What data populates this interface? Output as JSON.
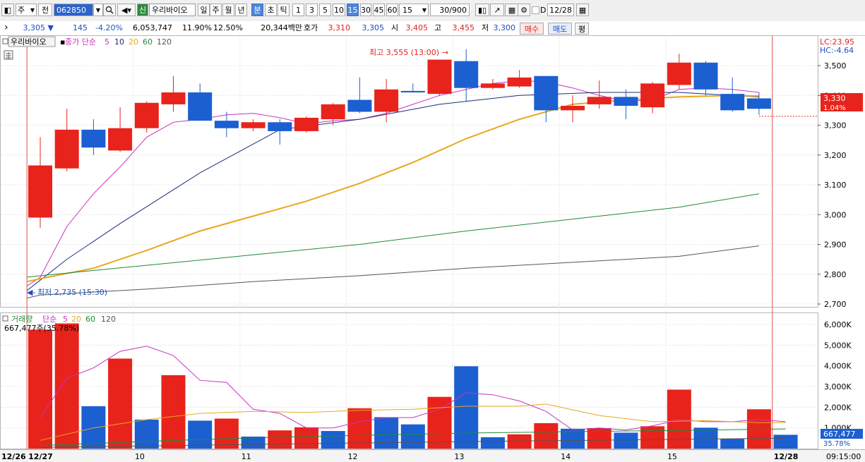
{
  "toolbar": {
    "market": "주",
    "view": "전",
    "code": "062850",
    "name": "우리바이오",
    "credit_badge": "신",
    "periods": [
      "일",
      "주",
      "월",
      "년",
      "분",
      "초",
      "틱"
    ],
    "selected_period": "분",
    "intervals": [
      "1",
      "3",
      "5",
      "10",
      "15",
      "30",
      "45",
      "60"
    ],
    "selected_interval": "15",
    "interval_value": "15",
    "count": "30/900",
    "date_value": "12/28",
    "date_checkbox_label": "D"
  },
  "quote": {
    "price": "3,305",
    "change": "145",
    "change_pct": "-4.20%",
    "volume": "6,053,747",
    "turnover_pct": "11.90%",
    "rate2": "12.50%",
    "amount": "20,344백만",
    "bid_label": "호가",
    "bid": "3,310",
    "ask": "3,305",
    "open_label": "시",
    "open": "3,405",
    "high_label": "고",
    "high": "3,455",
    "low_label": "저",
    "low": "3,300",
    "buy_button": "매수",
    "sell_button": "매도",
    "avg_button": "평"
  },
  "price_panel": {
    "stock_label": "우리바이오",
    "ma_title": "종가 단순",
    "ma_periods": [
      "5",
      "10",
      "20",
      "60",
      "120"
    ],
    "lc": "LC:23.95",
    "hc": "HC:-4.64",
    "current_price": "3,330",
    "current_pct": "1.04%",
    "high_annotation": "최고 3,555 (13:00)",
    "low_annotation": "최저 2,735 (15:30)"
  },
  "volume_panel": {
    "title": "거래량",
    "ma_title": "단순",
    "ma_periods": [
      "5",
      "20",
      "60",
      "120"
    ],
    "info": "667,477주(35.78%)",
    "current_volume": "667,477",
    "current_pct": "35.78%"
  },
  "xaxis": {
    "time_label": "09:15:00"
  },
  "colors": {
    "up": "#e8231b",
    "down": "#1b5fd1",
    "ma5": "#c833c0",
    "ma10": "#1a2f7a",
    "ma20": "#e8a81c",
    "ma60": "#1f8a3a",
    "ma120": "#555555"
  },
  "chart_data": {
    "type": "candlestick",
    "price_ylim": [
      2700,
      3600
    ],
    "price_ticks": [
      "3,500",
      "3,400",
      "3,300",
      "3,200",
      "3,100",
      "3,000",
      "2,900",
      "2,800",
      "2,700"
    ],
    "volume_ylim": [
      0,
      6000000
    ],
    "volume_ticks": [
      "6,000K",
      "5,000K",
      "4,000K",
      "3,000K",
      "2,000K",
      "1,000K"
    ],
    "x_labels": [
      {
        "label": "12/26",
        "index": -1
      },
      {
        "label": "12/27",
        "index": 0
      },
      {
        "label": "10",
        "index": 4
      },
      {
        "label": "11",
        "index": 8
      },
      {
        "label": "12",
        "index": 12
      },
      {
        "label": "13",
        "index": 16
      },
      {
        "label": "14",
        "index": 20
      },
      {
        "label": "15",
        "index": 24
      },
      {
        "label": "12/28",
        "index": 28
      }
    ],
    "candles": [
      {
        "o": 2990,
        "h": 3260,
        "l": 2955,
        "c": 3165
      },
      {
        "o": 3155,
        "h": 3355,
        "l": 3145,
        "c": 3285
      },
      {
        "o": 3285,
        "h": 3320,
        "l": 3200,
        "c": 3225
      },
      {
        "o": 3215,
        "h": 3360,
        "l": 3210,
        "c": 3290
      },
      {
        "o": 3290,
        "h": 3380,
        "l": 3275,
        "c": 3375
      },
      {
        "o": 3370,
        "h": 3465,
        "l": 3345,
        "c": 3410
      },
      {
        "o": 3410,
        "h": 3440,
        "l": 3315,
        "c": 3315
      },
      {
        "o": 3315,
        "h": 3345,
        "l": 3260,
        "c": 3290
      },
      {
        "o": 3290,
        "h": 3320,
        "l": 3280,
        "c": 3310
      },
      {
        "o": 3310,
        "h": 3320,
        "l": 3235,
        "c": 3280
      },
      {
        "o": 3280,
        "h": 3330,
        "l": 3275,
        "c": 3325
      },
      {
        "o": 3320,
        "h": 3375,
        "l": 3300,
        "c": 3370
      },
      {
        "o": 3385,
        "h": 3460,
        "l": 3340,
        "c": 3345
      },
      {
        "o": 3345,
        "h": 3455,
        "l": 3310,
        "c": 3420
      },
      {
        "o": 3415,
        "h": 3440,
        "l": 3410,
        "c": 3410
      },
      {
        "o": 3405,
        "h": 3520,
        "l": 3400,
        "c": 3520
      },
      {
        "o": 3515,
        "h": 3555,
        "l": 3380,
        "c": 3425
      },
      {
        "o": 3425,
        "h": 3455,
        "l": 3420,
        "c": 3440
      },
      {
        "o": 3430,
        "h": 3485,
        "l": 3425,
        "c": 3460
      },
      {
        "o": 3465,
        "h": 3465,
        "l": 3310,
        "c": 3350
      },
      {
        "o": 3350,
        "h": 3400,
        "l": 3310,
        "c": 3365
      },
      {
        "o": 3370,
        "h": 3450,
        "l": 3355,
        "c": 3395
      },
      {
        "o": 3395,
        "h": 3420,
        "l": 3320,
        "c": 3365
      },
      {
        "o": 3360,
        "h": 3445,
        "l": 3340,
        "c": 3440
      },
      {
        "o": 3435,
        "h": 3540,
        "l": 3420,
        "c": 3510
      },
      {
        "o": 3510,
        "h": 3515,
        "l": 3400,
        "c": 3420
      },
      {
        "o": 3405,
        "h": 3460,
        "l": 3345,
        "c": 3350
      },
      {
        "o": 3390,
        "h": 3410,
        "l": 3335,
        "c": 3355
      }
    ],
    "volumes": [
      {
        "v": 5750000,
        "up": true
      },
      {
        "v": 6050000,
        "up": true
      },
      {
        "v": 2050000,
        "up": false
      },
      {
        "v": 4350000,
        "up": true
      },
      {
        "v": 1400000,
        "up": false
      },
      {
        "v": 3550000,
        "up": true
      },
      {
        "v": 1350000,
        "up": false
      },
      {
        "v": 1450000,
        "up": true
      },
      {
        "v": 580000,
        "up": false
      },
      {
        "v": 880000,
        "up": true
      },
      {
        "v": 1030000,
        "up": true
      },
      {
        "v": 850000,
        "up": false
      },
      {
        "v": 1950000,
        "up": true
      },
      {
        "v": 1520000,
        "up": false
      },
      {
        "v": 1170000,
        "up": false
      },
      {
        "v": 2500000,
        "up": true
      },
      {
        "v": 3980000,
        "up": false
      },
      {
        "v": 550000,
        "up": false
      },
      {
        "v": 690000,
        "up": true
      },
      {
        "v": 1230000,
        "up": true
      },
      {
        "v": 960000,
        "up": false
      },
      {
        "v": 990000,
        "up": true
      },
      {
        "v": 770000,
        "up": false
      },
      {
        "v": 1080000,
        "up": true
      },
      {
        "v": 2850000,
        "up": true
      },
      {
        "v": 1010000,
        "up": false
      },
      {
        "v": 470000,
        "up": false
      },
      {
        "v": 1900000,
        "up": true
      },
      {
        "v": 667477,
        "up": false
      }
    ],
    "ma_lines": [
      {
        "name": "5",
        "points": [
          [
            -0.5,
            2760
          ],
          [
            0,
            2790
          ],
          [
            1,
            2960
          ],
          [
            2,
            3070
          ],
          [
            3,
            3160
          ],
          [
            4,
            3260
          ],
          [
            5,
            3310
          ],
          [
            6,
            3320
          ],
          [
            7,
            3335
          ],
          [
            8,
            3340
          ],
          [
            9,
            3325
          ],
          [
            10,
            3305
          ],
          [
            11,
            3315
          ],
          [
            12,
            3320
          ],
          [
            13,
            3340
          ],
          [
            14,
            3370
          ],
          [
            15,
            3400
          ],
          [
            16,
            3420
          ],
          [
            17,
            3440
          ],
          [
            18,
            3450
          ],
          [
            19,
            3445
          ],
          [
            20,
            3425
          ],
          [
            21,
            3400
          ],
          [
            22,
            3380
          ],
          [
            23,
            3385
          ],
          [
            24,
            3420
          ],
          [
            25,
            3425
          ],
          [
            26,
            3420
          ],
          [
            27,
            3410
          ]
        ]
      },
      {
        "name": "10",
        "points": [
          [
            -0.5,
            2745
          ],
          [
            0,
            2780
          ],
          [
            1,
            2850
          ],
          [
            3,
            2970
          ],
          [
            6,
            3140
          ],
          [
            9,
            3285
          ],
          [
            12,
            3320
          ],
          [
            15,
            3370
          ],
          [
            18,
            3400
          ],
          [
            21,
            3410
          ],
          [
            24,
            3410
          ],
          [
            27,
            3395
          ]
        ]
      },
      {
        "name": "20",
        "points": [
          [
            -0.5,
            2775
          ],
          [
            0,
            2785
          ],
          [
            2,
            2820
          ],
          [
            4,
            2880
          ],
          [
            6,
            2945
          ],
          [
            8,
            2995
          ],
          [
            10,
            3045
          ],
          [
            12,
            3105
          ],
          [
            14,
            3175
          ],
          [
            16,
            3255
          ],
          [
            18,
            3320
          ],
          [
            20,
            3370
          ],
          [
            22,
            3385
          ],
          [
            24,
            3395
          ],
          [
            26,
            3400
          ],
          [
            27,
            3398
          ]
        ]
      },
      {
        "name": "60",
        "points": [
          [
            -0.5,
            2790
          ],
          [
            0,
            2795
          ],
          [
            4,
            2830
          ],
          [
            8,
            2865
          ],
          [
            12,
            2900
          ],
          [
            16,
            2945
          ],
          [
            20,
            2985
          ],
          [
            24,
            3025
          ],
          [
            27,
            3070
          ]
        ]
      },
      {
        "name": "120",
        "points": [
          [
            -0.5,
            2720
          ],
          [
            0,
            2730
          ],
          [
            4,
            2750
          ],
          [
            8,
            2775
          ],
          [
            12,
            2795
          ],
          [
            16,
            2820
          ],
          [
            20,
            2840
          ],
          [
            24,
            2860
          ],
          [
            27,
            2895
          ]
        ]
      }
    ],
    "vol_ma_lines": [
      {
        "name": "5",
        "points": [
          [
            0,
            1500000
          ],
          [
            1,
            3400000
          ],
          [
            2,
            3900000
          ],
          [
            3,
            4700000
          ],
          [
            4,
            4950000
          ],
          [
            5,
            4500000
          ],
          [
            6,
            3300000
          ],
          [
            7,
            3200000
          ],
          [
            8,
            1900000
          ],
          [
            9,
            1700000
          ],
          [
            10,
            1000000
          ],
          [
            11,
            1000000
          ],
          [
            12,
            1300000
          ],
          [
            13,
            1500000
          ],
          [
            14,
            1500000
          ],
          [
            15,
            1900000
          ],
          [
            16,
            2700000
          ],
          [
            17,
            2600000
          ],
          [
            18,
            2300000
          ],
          [
            19,
            1800000
          ],
          [
            20,
            900000
          ],
          [
            21,
            1000000
          ],
          [
            22,
            900000
          ],
          [
            23,
            1100000
          ],
          [
            24,
            1400000
          ],
          [
            25,
            1300000
          ],
          [
            26,
            1300000
          ],
          [
            27,
            1400000
          ],
          [
            28,
            1300000
          ]
        ]
      },
      {
        "name": "20",
        "points": [
          [
            0,
            400000
          ],
          [
            2,
            1000000
          ],
          [
            4,
            1400000
          ],
          [
            6,
            1700000
          ],
          [
            8,
            1800000
          ],
          [
            10,
            1750000
          ],
          [
            12,
            1850000
          ],
          [
            14,
            1900000
          ],
          [
            16,
            2050000
          ],
          [
            18,
            2050000
          ],
          [
            19,
            2150000
          ],
          [
            21,
            1600000
          ],
          [
            23,
            1300000
          ],
          [
            25,
            1350000
          ],
          [
            27,
            1250000
          ],
          [
            28,
            1250000
          ]
        ]
      },
      {
        "name": "60",
        "points": [
          [
            0,
            150000
          ],
          [
            4,
            350000
          ],
          [
            8,
            520000
          ],
          [
            12,
            640000
          ],
          [
            16,
            750000
          ],
          [
            20,
            820000
          ],
          [
            24,
            880000
          ],
          [
            28,
            950000
          ]
        ]
      },
      {
        "name": "120",
        "points": [
          [
            0,
            60000
          ],
          [
            8,
            200000
          ],
          [
            16,
            340000
          ],
          [
            28,
            500000
          ]
        ]
      }
    ]
  }
}
